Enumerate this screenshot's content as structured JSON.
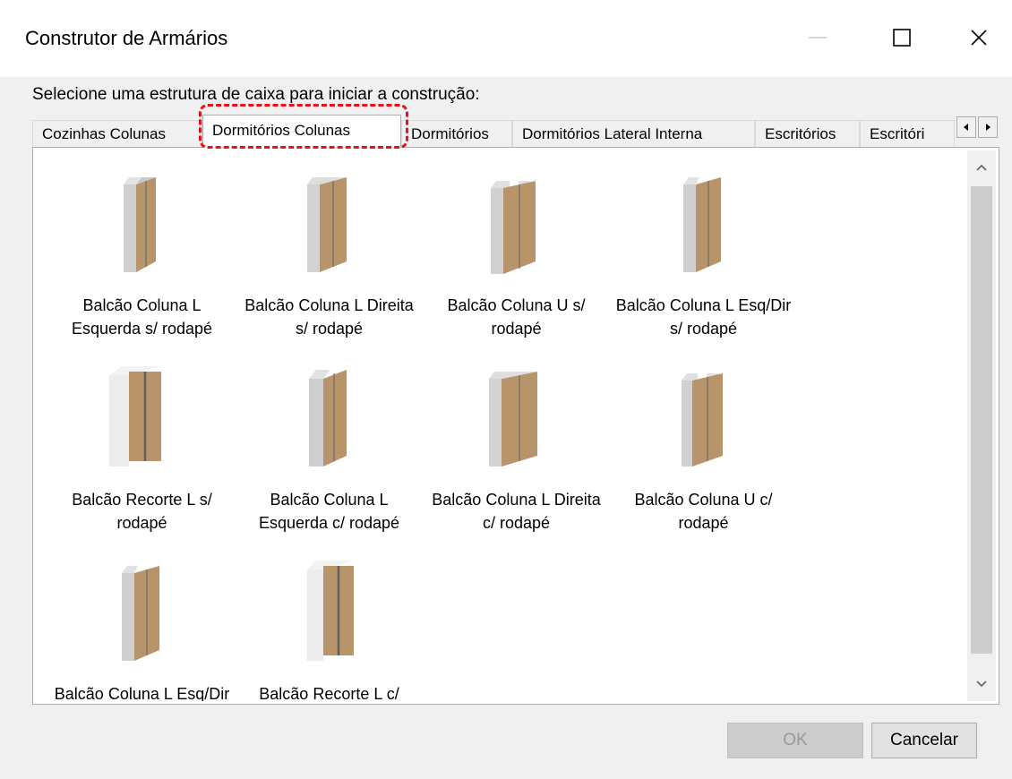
{
  "window": {
    "title": "Construtor de Armários"
  },
  "prompt": "Selecione uma estrutura de caixa para iniciar a construção:",
  "tabs": [
    {
      "label": "Cozinhas Colunas"
    },
    {
      "label": "Dormitórios Colunas",
      "active": true
    },
    {
      "label": "Dormitórios"
    },
    {
      "label": "Dormitórios Lateral Interna"
    },
    {
      "label": "Escritórios"
    },
    {
      "label": "Escritóri"
    }
  ],
  "items": [
    {
      "label": "Balcão Coluna L Esquerda s/ rodapé",
      "icon": "cabinet-l-left-icon"
    },
    {
      "label": "Balcão Coluna L Direita s/ rodapé",
      "icon": "cabinet-l-right-icon"
    },
    {
      "label": "Balcão Coluna U s/ rodapé",
      "icon": "cabinet-u-icon"
    },
    {
      "label": "Balcão Coluna L Esq/Dir s/ rodapé",
      "icon": "cabinet-l-both-icon"
    },
    {
      "label": "Balcão Recorte L s/ rodapé",
      "icon": "cabinet-cutout-icon"
    },
    {
      "label": "Balcão Coluna L Esquerda c/ rodapé",
      "icon": "cabinet-l-left-icon"
    },
    {
      "label": "Balcão Coluna L Direita c/ rodapé",
      "icon": "cabinet-l-right-icon"
    },
    {
      "label": "Balcão Coluna U c/ rodapé",
      "icon": "cabinet-u-icon"
    },
    {
      "label": "Balcão Coluna L Esq/Dir c/ rodapé",
      "icon": "cabinet-l-both-icon"
    },
    {
      "label": "Balcão Recorte L c/ rodapé",
      "icon": "cabinet-cutout-icon"
    }
  ],
  "buttons": {
    "ok": "OK",
    "cancel": "Cancelar"
  },
  "colors": {
    "highlight": "#e8111b",
    "wood": "#b8946a",
    "carcass": "#d0d0d0"
  }
}
